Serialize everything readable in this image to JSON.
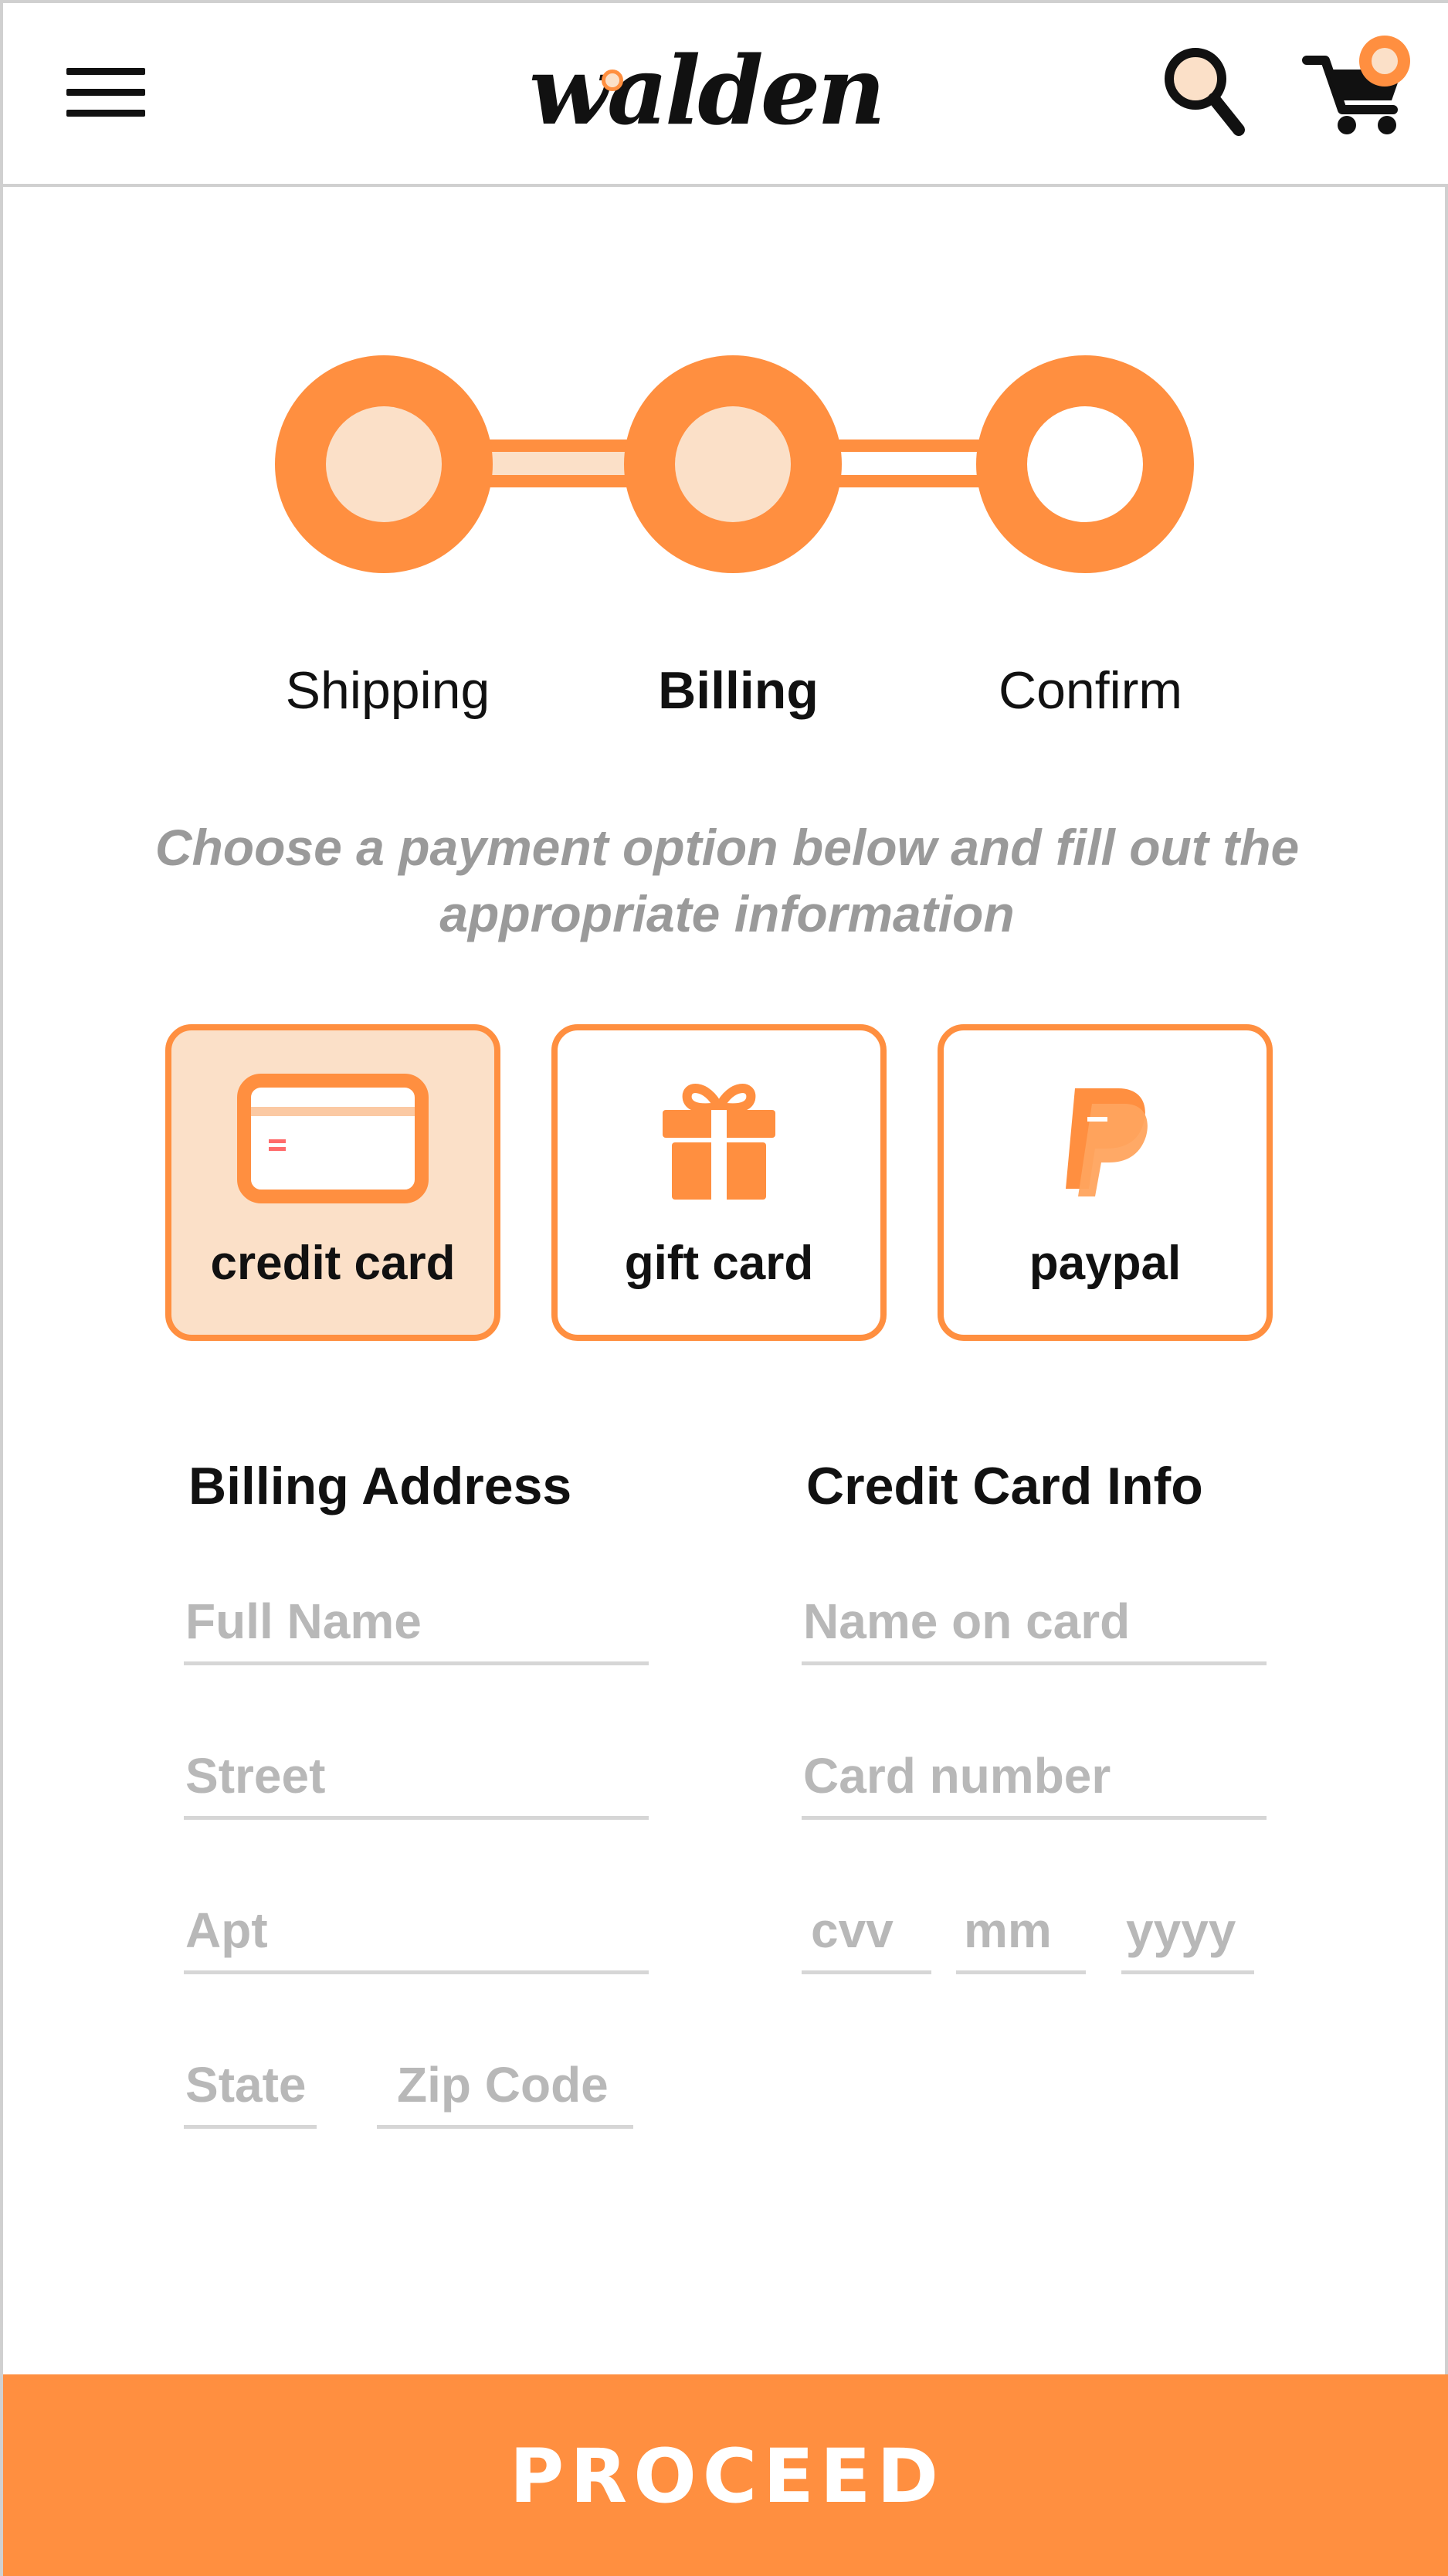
{
  "colors": {
    "accent": "#ff8f40",
    "accent_light": "#fbe0c8",
    "text": "#111111",
    "muted_text": "#9a9a9a",
    "placeholder": "#b8b8b8",
    "divider": "#d0d0d0"
  },
  "header": {
    "logo_text": "walden",
    "menu_icon": "hamburger-menu-icon",
    "search_icon": "search-icon",
    "cart_icon": "shopping-cart-icon"
  },
  "stepper": {
    "steps": [
      {
        "label": "Shipping",
        "state": "complete"
      },
      {
        "label": "Billing",
        "state": "current"
      },
      {
        "label": "Confirm",
        "state": "upcoming"
      }
    ]
  },
  "instructions": "Choose a payment option below and fill out the appropriate information",
  "payment_options": [
    {
      "label": "credit card",
      "icon": "credit-card-icon",
      "selected": true
    },
    {
      "label": "gift card",
      "icon": "gift-icon",
      "selected": false
    },
    {
      "label": "paypal",
      "icon": "paypal-icon",
      "selected": false
    }
  ],
  "billing_address": {
    "title": "Billing Address",
    "full_name_placeholder": "Full Name",
    "street_placeholder": "Street",
    "apt_placeholder": "Apt",
    "state_placeholder": "State",
    "zip_placeholder": "Zip Code"
  },
  "credit_card_info": {
    "title": "Credit Card Info",
    "name_on_card_placeholder": "Name on card",
    "card_number_placeholder": "Card number",
    "cvv_placeholder": "cvv",
    "month_placeholder": "mm",
    "year_placeholder": "yyyy"
  },
  "proceed_label": "PROCEED"
}
